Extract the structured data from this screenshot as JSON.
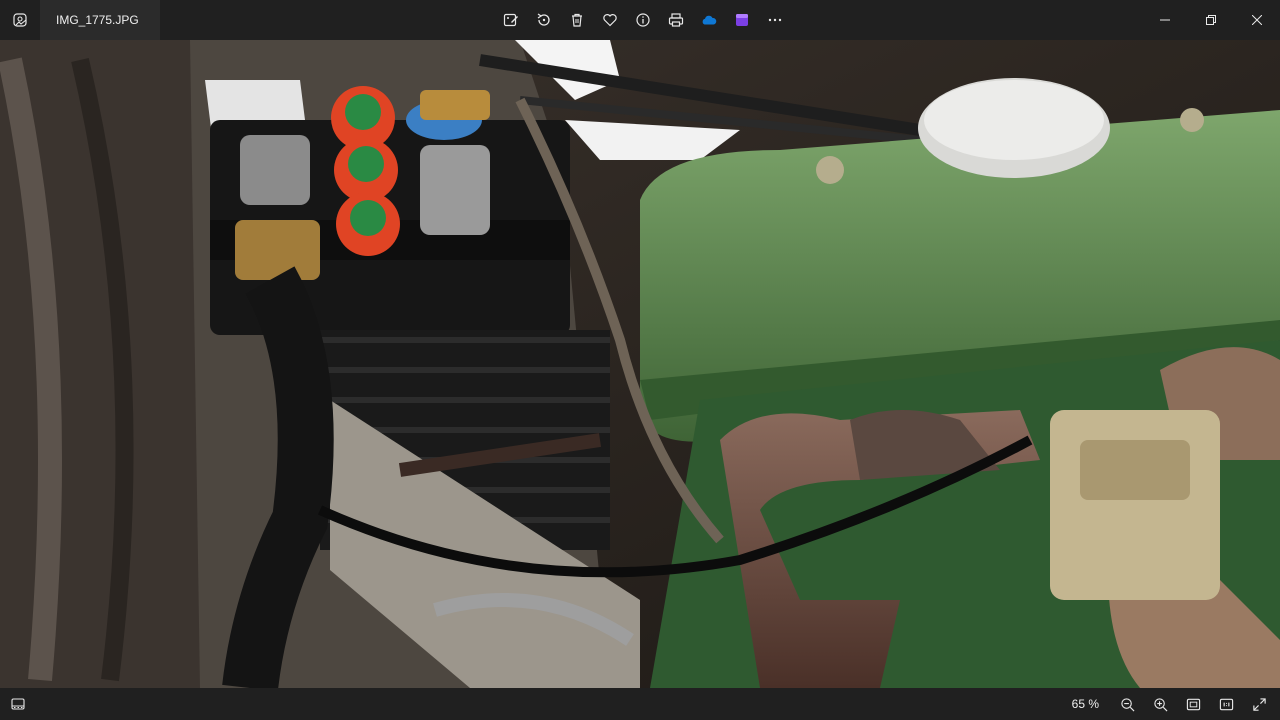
{
  "window": {
    "file_name": "IMG_1775.JPG",
    "app_icon": "photos-app-icon"
  },
  "toolbar": {
    "items": [
      {
        "name": "edit-image-button",
        "icon": "edit-image-icon"
      },
      {
        "name": "rotate-button",
        "icon": "rotate-icon"
      },
      {
        "name": "delete-button",
        "icon": "trash-icon"
      },
      {
        "name": "favorite-button",
        "icon": "heart-icon"
      },
      {
        "name": "file-info-button",
        "icon": "info-icon"
      },
      {
        "name": "print-button",
        "icon": "printer-icon"
      },
      {
        "name": "onedrive-button",
        "icon": "cloud-icon"
      },
      {
        "name": "clipchamp-button",
        "icon": "video-editor-icon"
      },
      {
        "name": "more-options-button",
        "icon": "more-icon"
      }
    ]
  },
  "window_controls": [
    "minimize",
    "maximize",
    "close"
  ],
  "viewer": {
    "image_description_icon": "photo-engine-bay-image"
  },
  "statusbar": {
    "zoom_text": "65 %",
    "buttons": [
      {
        "name": "zoom-out-button",
        "icon": "zoom-out-icon"
      },
      {
        "name": "zoom-in-button",
        "icon": "zoom-in-icon"
      },
      {
        "name": "fit-to-window-button",
        "icon": "fit-window-icon"
      },
      {
        "name": "actual-size-button",
        "icon": "actual-size-icon"
      },
      {
        "name": "full-screen-button",
        "icon": "expand-icon"
      }
    ]
  },
  "colors": {
    "chrome": "#202020",
    "onedrive": "#0f78d4",
    "clipchamp": "#7b3fe4"
  }
}
